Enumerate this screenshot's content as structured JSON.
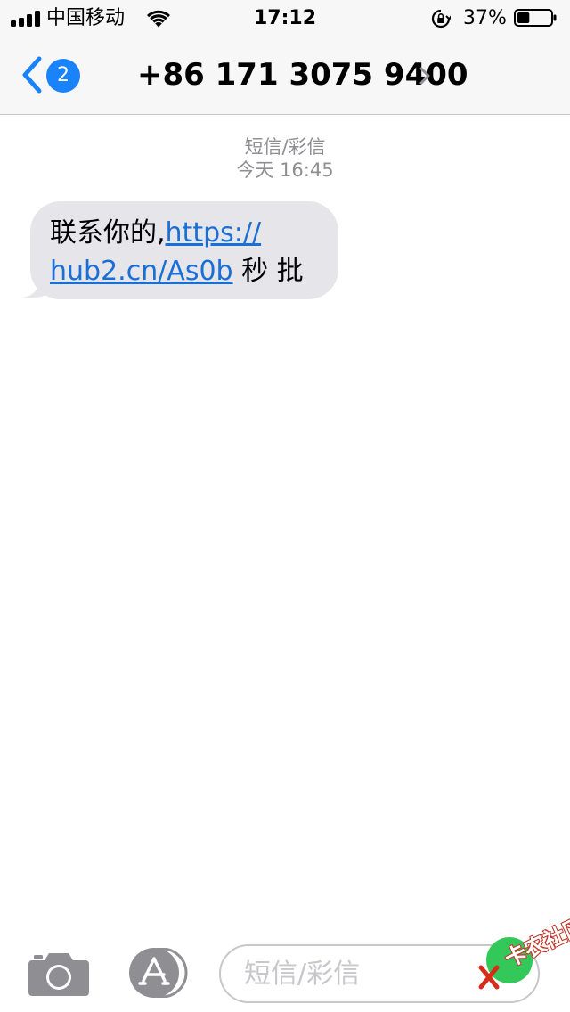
{
  "status_bar": {
    "carrier": "中国移动",
    "time": "17:12",
    "battery_percent": "37%",
    "battery_level": 0.37,
    "signal_bars": 4,
    "icons": [
      "signal-icon",
      "wifi-icon",
      "rotation-lock-icon",
      "battery-icon"
    ]
  },
  "nav": {
    "back_badge_count": "2",
    "contact_title": "+86 171 3075 9400"
  },
  "thread": {
    "service_label": "短信/彩信",
    "timestamp": "今天 16:45",
    "messages": [
      {
        "direction": "incoming",
        "line1_text": "联系你的,",
        "line1_link": "https://",
        "line2_link": "hub2.cn/As0b",
        "line2_text": " 秒 批"
      }
    ]
  },
  "input_bar": {
    "placeholder": "短信/彩信",
    "icons": [
      "camera-icon",
      "app-store-icon"
    ]
  },
  "watermark": {
    "text": "卡农社区",
    "logo": "kanong-logo"
  },
  "colors": {
    "accent": "#1a82fb",
    "link": "#1a6fd6",
    "incoming_bubble": "#e5e5ea",
    "meta_text": "#8e8e93",
    "bar_background": "#f7f7f7",
    "icon_gray": "#8e8e93"
  }
}
